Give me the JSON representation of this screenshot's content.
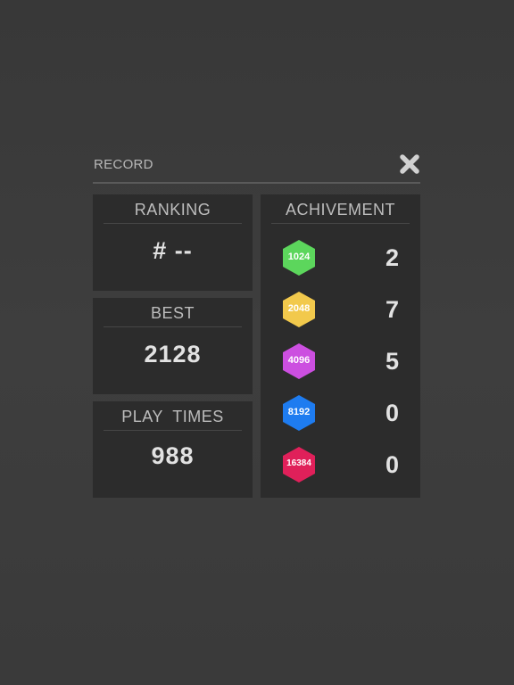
{
  "dialog": {
    "title": "RECORD",
    "close_icon": "close-x-icon"
  },
  "stats": {
    "ranking": {
      "label": "RANKING",
      "value": "# --"
    },
    "best": {
      "label": "BEST",
      "value": "2128"
    },
    "play_times": {
      "label": "PLAY  TIMES",
      "value": "988"
    }
  },
  "achievement": {
    "label": "ACHIVEMENT",
    "tiles": [
      {
        "tile": "1024",
        "count": "2",
        "color": "#5cd65c"
      },
      {
        "tile": "2048",
        "count": "7",
        "color": "#f2c94c"
      },
      {
        "tile": "4096",
        "count": "5",
        "color": "#cc4fe0"
      },
      {
        "tile": "8192",
        "count": "0",
        "color": "#1e7cf0"
      },
      {
        "tile": "16384",
        "count": "0",
        "color": "#e0205a"
      }
    ]
  },
  "colors": {
    "background": "#3c3c3c",
    "panel": "#2c2c2c",
    "text": "#e2e2e2",
    "label": "#bdbdbd"
  }
}
